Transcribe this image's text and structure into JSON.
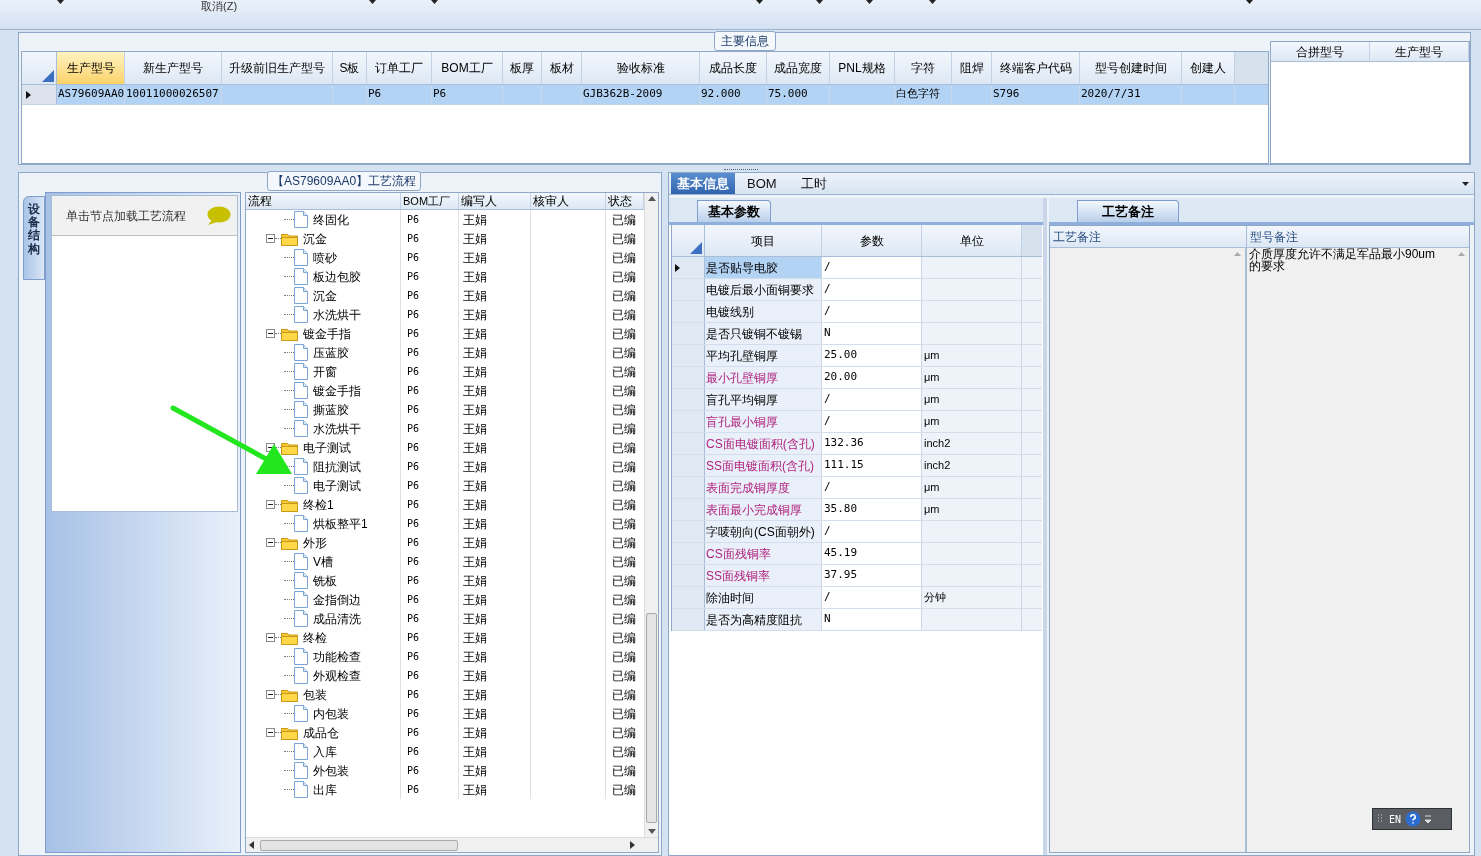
{
  "toolbar": {
    "cancel_button": "取消(Z)"
  },
  "main_info": {
    "title": "主要信息",
    "columns": [
      {
        "label": "生产型号",
        "selected": true
      },
      {
        "label": "新生产型号",
        "selected": false
      },
      {
        "label": "升级前旧生产型号",
        "selected": false
      },
      {
        "label": "S板",
        "selected": false
      },
      {
        "label": "订单工厂",
        "selected": false
      },
      {
        "label": "BOM工厂",
        "selected": false
      },
      {
        "label": "板厚",
        "selected": false
      },
      {
        "label": "板材",
        "selected": false
      },
      {
        "label": "验收标准",
        "selected": false
      },
      {
        "label": "成品长度",
        "selected": false
      },
      {
        "label": "成品宽度",
        "selected": false
      },
      {
        "label": "PNL规格",
        "selected": false
      },
      {
        "label": "字符",
        "selected": false
      },
      {
        "label": "阻焊",
        "selected": false
      },
      {
        "label": "终端客户代码",
        "selected": false
      },
      {
        "label": "型号创建时间",
        "selected": false
      },
      {
        "label": "创建人",
        "selected": false
      }
    ],
    "rows": [
      {
        "selected": true,
        "cells": [
          "AS79609AA0",
          "10011000026507",
          null,
          null,
          "P6",
          "P6",
          null,
          null,
          "GJB362B-2009",
          "92.000",
          "75.000",
          null,
          "白色字符",
          null,
          "S796",
          "2020/7/31",
          null
        ]
      }
    ],
    "side_columns": [
      "合拼型号",
      "生产型号"
    ]
  },
  "process": {
    "title": "【AS79609AA0】工艺流程",
    "side_tab": "设备结构",
    "hint": "单击节点加载工艺流程",
    "columns": [
      "流程",
      "BOM工厂",
      "编写人",
      "核审人",
      "状态"
    ],
    "tree": [
      {
        "children": [
          {
            "label": "终固化",
            "bom": "P6",
            "writer": "王娟",
            "status": "已编"
          }
        ]
      },
      {
        "label": "沉金",
        "bom": "P6",
        "writer": "王娟",
        "status": "已编",
        "expanded": true,
        "children": [
          {
            "label": "喷砂",
            "bom": "P6",
            "writer": "王娟",
            "status": "已编"
          },
          {
            "label": "板边包胶",
            "bom": "P6",
            "writer": "王娟",
            "status": "已编"
          },
          {
            "label": "沉金",
            "bom": "P6",
            "writer": "王娟",
            "status": "已编"
          },
          {
            "label": "水洗烘干",
            "bom": "P6",
            "writer": "王娟",
            "status": "已编"
          }
        ]
      },
      {
        "label": "镀金手指",
        "bom": "P6",
        "writer": "王娟",
        "status": "已编",
        "expanded": true,
        "children": [
          {
            "label": "压蓝胶",
            "bom": "P6",
            "writer": "王娟",
            "status": "已编"
          },
          {
            "label": "开窗",
            "bom": "P6",
            "writer": "王娟",
            "status": "已编"
          },
          {
            "label": "镀金手指",
            "bom": "P6",
            "writer": "王娟",
            "status": "已编"
          },
          {
            "label": "撕蓝胶",
            "bom": "P6",
            "writer": "王娟",
            "status": "已编"
          },
          {
            "label": "水洗烘干",
            "bom": "P6",
            "writer": "王娟",
            "status": "已编"
          }
        ]
      },
      {
        "label": "电子测试",
        "bom": "P6",
        "writer": "王娟",
        "status": "已编",
        "expanded": true,
        "children": [
          {
            "label": "阻抗测试",
            "bom": "P6",
            "writer": "王娟",
            "status": "已编"
          },
          {
            "label": "电子测试",
            "bom": "P6",
            "writer": "王娟",
            "status": "已编"
          }
        ]
      },
      {
        "label": "终检1",
        "bom": "P6",
        "writer": "王娟",
        "status": "已编",
        "expanded": true,
        "children": [
          {
            "label": "烘板整平1",
            "bom": "P6",
            "writer": "王娟",
            "status": "已编"
          }
        ]
      },
      {
        "label": "外形",
        "bom": "P6",
        "writer": "王娟",
        "status": "已编",
        "expanded": true,
        "children": [
          {
            "label": "V槽",
            "bom": "P6",
            "writer": "王娟",
            "status": "已编"
          },
          {
            "label": "铣板",
            "bom": "P6",
            "writer": "王娟",
            "status": "已编"
          },
          {
            "label": "金指倒边",
            "bom": "P6",
            "writer": "王娟",
            "status": "已编"
          },
          {
            "label": "成品清洗",
            "bom": "P6",
            "writer": "王娟",
            "status": "已编"
          }
        ]
      },
      {
        "label": "终检",
        "bom": "P6",
        "writer": "王娟",
        "status": "已编",
        "expanded": true,
        "children": [
          {
            "label": "功能检查",
            "bom": "P6",
            "writer": "王娟",
            "status": "已编"
          },
          {
            "label": "外观检查",
            "bom": "P6",
            "writer": "王娟",
            "status": "已编"
          }
        ]
      },
      {
        "label": "包装",
        "bom": "P6",
        "writer": "王娟",
        "status": "已编",
        "expanded": true,
        "children": [
          {
            "label": "内包装",
            "bom": "P6",
            "writer": "王娟",
            "status": "已编"
          }
        ]
      },
      {
        "label": "成品仓",
        "bom": "P6",
        "writer": "王娟",
        "status": "已编",
        "expanded": true,
        "children": [
          {
            "label": "入库",
            "bom": "P6",
            "writer": "王娟",
            "status": "已编"
          },
          {
            "label": "外包装",
            "bom": "P6",
            "writer": "王娟",
            "status": "已编"
          },
          {
            "label": "出库",
            "bom": "P6",
            "writer": "王娟",
            "status": "已编"
          }
        ]
      }
    ]
  },
  "details": {
    "tabs": [
      {
        "label": "基本信息",
        "selected": true
      },
      {
        "label": "BOM",
        "selected": false
      },
      {
        "label": "工时",
        "selected": false
      }
    ],
    "params": {
      "tab": "基本参数",
      "columns": [
        "项目",
        "参数",
        "单位"
      ],
      "rows": [
        {
          "item": "是否贴导电胶",
          "value": "/",
          "highlighted": false,
          "selected": true
        },
        {
          "item": "电镀后最小面铜要求",
          "value": "/",
          "highlighted": false,
          "selected": false
        },
        {
          "item": "电镀线别",
          "value": "/",
          "highlighted": false,
          "selected": false
        },
        {
          "item": "是否只镀铜不镀锡",
          "value": "N",
          "highlighted": false,
          "selected": false
        },
        {
          "item": "平均孔壁铜厚",
          "value": "25.00",
          "unit": "μm",
          "highlighted": false,
          "selected": false
        },
        {
          "item": "最小孔壁铜厚",
          "value": "20.00",
          "unit": "μm",
          "highlighted": true,
          "selected": false
        },
        {
          "item": "盲孔平均铜厚",
          "value": "/",
          "unit": "μm",
          "highlighted": false,
          "selected": false
        },
        {
          "item": "盲孔最小铜厚",
          "value": "/",
          "unit": "μm",
          "highlighted": true,
          "selected": false
        },
        {
          "item": "CS面电镀面积(含孔)",
          "value": "132.36",
          "unit": "inch2",
          "highlighted": true,
          "selected": false
        },
        {
          "item": "SS面电镀面积(含孔)",
          "value": "111.15",
          "unit": "inch2",
          "highlighted": true,
          "selected": false
        },
        {
          "item": "表面完成铜厚度",
          "value": "/",
          "unit": "μm",
          "highlighted": true,
          "selected": false
        },
        {
          "item": "表面最小完成铜厚",
          "value": "35.80",
          "unit": "μm",
          "highlighted": true,
          "selected": false
        },
        {
          "item": "字唛朝向(CS面朝外)",
          "value": "/",
          "highlighted": false,
          "selected": false
        },
        {
          "item": "CS面残铜率",
          "value": "45.19",
          "highlighted": true,
          "selected": false
        },
        {
          "item": "SS面残铜率",
          "value": "37.95",
          "highlighted": true,
          "selected": false
        },
        {
          "item": "除油时间",
          "value": "/",
          "unit": "分钟",
          "highlighted": false,
          "selected": false
        },
        {
          "item": "是否为高精度阻抗",
          "value": "N",
          "highlighted": false,
          "selected": false
        }
      ]
    },
    "notes": {
      "tab": "工艺备注",
      "columns": [
        "工艺备注",
        "型号备注"
      ],
      "model_note": "介质厚度允许不满足军品最小90um的要求"
    }
  },
  "ime": {
    "label": "EN"
  }
}
